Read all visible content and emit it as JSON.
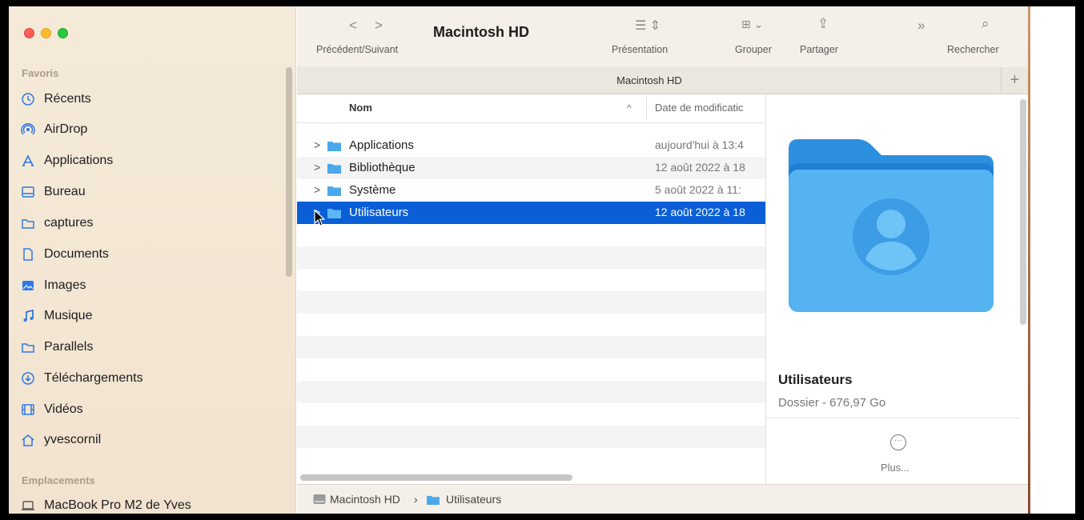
{
  "window": {
    "title": "Macintosh HD",
    "tab_title": "Macintosh HD"
  },
  "toolbar": {
    "nav_label": "Précédent/Suivant",
    "presentation_label": "Présentation",
    "group_label": "Grouper",
    "share_label": "Partager",
    "search_label": "Rechercher"
  },
  "sidebar": {
    "favorites_header": "Favoris",
    "items": [
      {
        "label": "Récents",
        "icon": "clock-icon"
      },
      {
        "label": "AirDrop",
        "icon": "airdrop-icon"
      },
      {
        "label": "Applications",
        "icon": "applications-icon"
      },
      {
        "label": "Bureau",
        "icon": "desktop-icon"
      },
      {
        "label": "captures",
        "icon": "folder-icon"
      },
      {
        "label": "Documents",
        "icon": "document-icon"
      },
      {
        "label": "Images",
        "icon": "photo-icon"
      },
      {
        "label": "Musique",
        "icon": "music-icon"
      },
      {
        "label": "Parallels",
        "icon": "folder-icon"
      },
      {
        "label": "Téléchargements",
        "icon": "download-icon"
      },
      {
        "label": "Vidéos",
        "icon": "film-icon"
      },
      {
        "label": "yvescornil",
        "icon": "home-icon"
      }
    ],
    "locations_header": "Emplacements",
    "locations": [
      {
        "label": "MacBook Pro M2 de Yves",
        "icon": "laptop-icon"
      }
    ]
  },
  "list": {
    "col_name": "Nom",
    "col_date": "Date de modificatic",
    "rows": [
      {
        "name": "Applications",
        "date": "aujourd'hui à 13:4"
      },
      {
        "name": "Bibliothèque",
        "date": "12 août 2022 à 18"
      },
      {
        "name": "Système",
        "date": "5 août 2022 à 11:"
      },
      {
        "name": "Utilisateurs",
        "date": "12 août 2022 à 18"
      }
    ]
  },
  "preview": {
    "name": "Utilisateurs",
    "info": "Dossier - 676,97 Go",
    "more_label": "Plus..."
  },
  "pathbar": {
    "segments": [
      "Macintosh HD",
      "›",
      "Utilisateurs"
    ]
  },
  "colors": {
    "accent": "#0a5fd6",
    "folder": "#4aa8ec",
    "sidebar_bg": "#f4e8d6"
  }
}
